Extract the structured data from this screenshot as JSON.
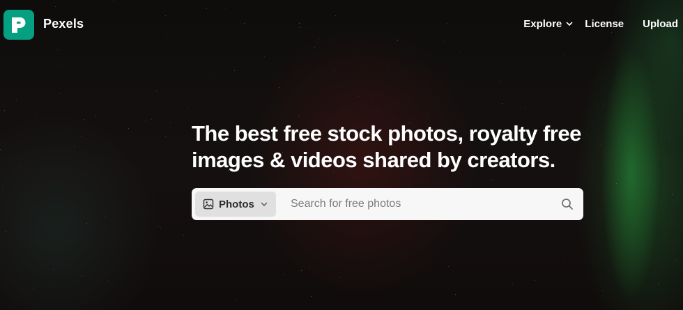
{
  "header": {
    "brand": "Pexels",
    "nav": [
      {
        "label": "Explore",
        "has_dropdown": true
      },
      {
        "label": "License",
        "has_dropdown": false
      },
      {
        "label": "Upload",
        "has_dropdown": false
      }
    ]
  },
  "hero": {
    "headline_line1": "The best free stock photos, royalty free",
    "headline_line2": "images & videos shared by creators."
  },
  "search": {
    "type_label": "Photos",
    "placeholder": "Search for free photos"
  },
  "colors": {
    "brand": "#05a081",
    "search_bg": "#f7f7f7",
    "type_select_bg": "#e0e0e0"
  },
  "icons": [
    "pexels-logo-icon",
    "chevron-down-icon",
    "image-icon",
    "search-icon"
  ]
}
